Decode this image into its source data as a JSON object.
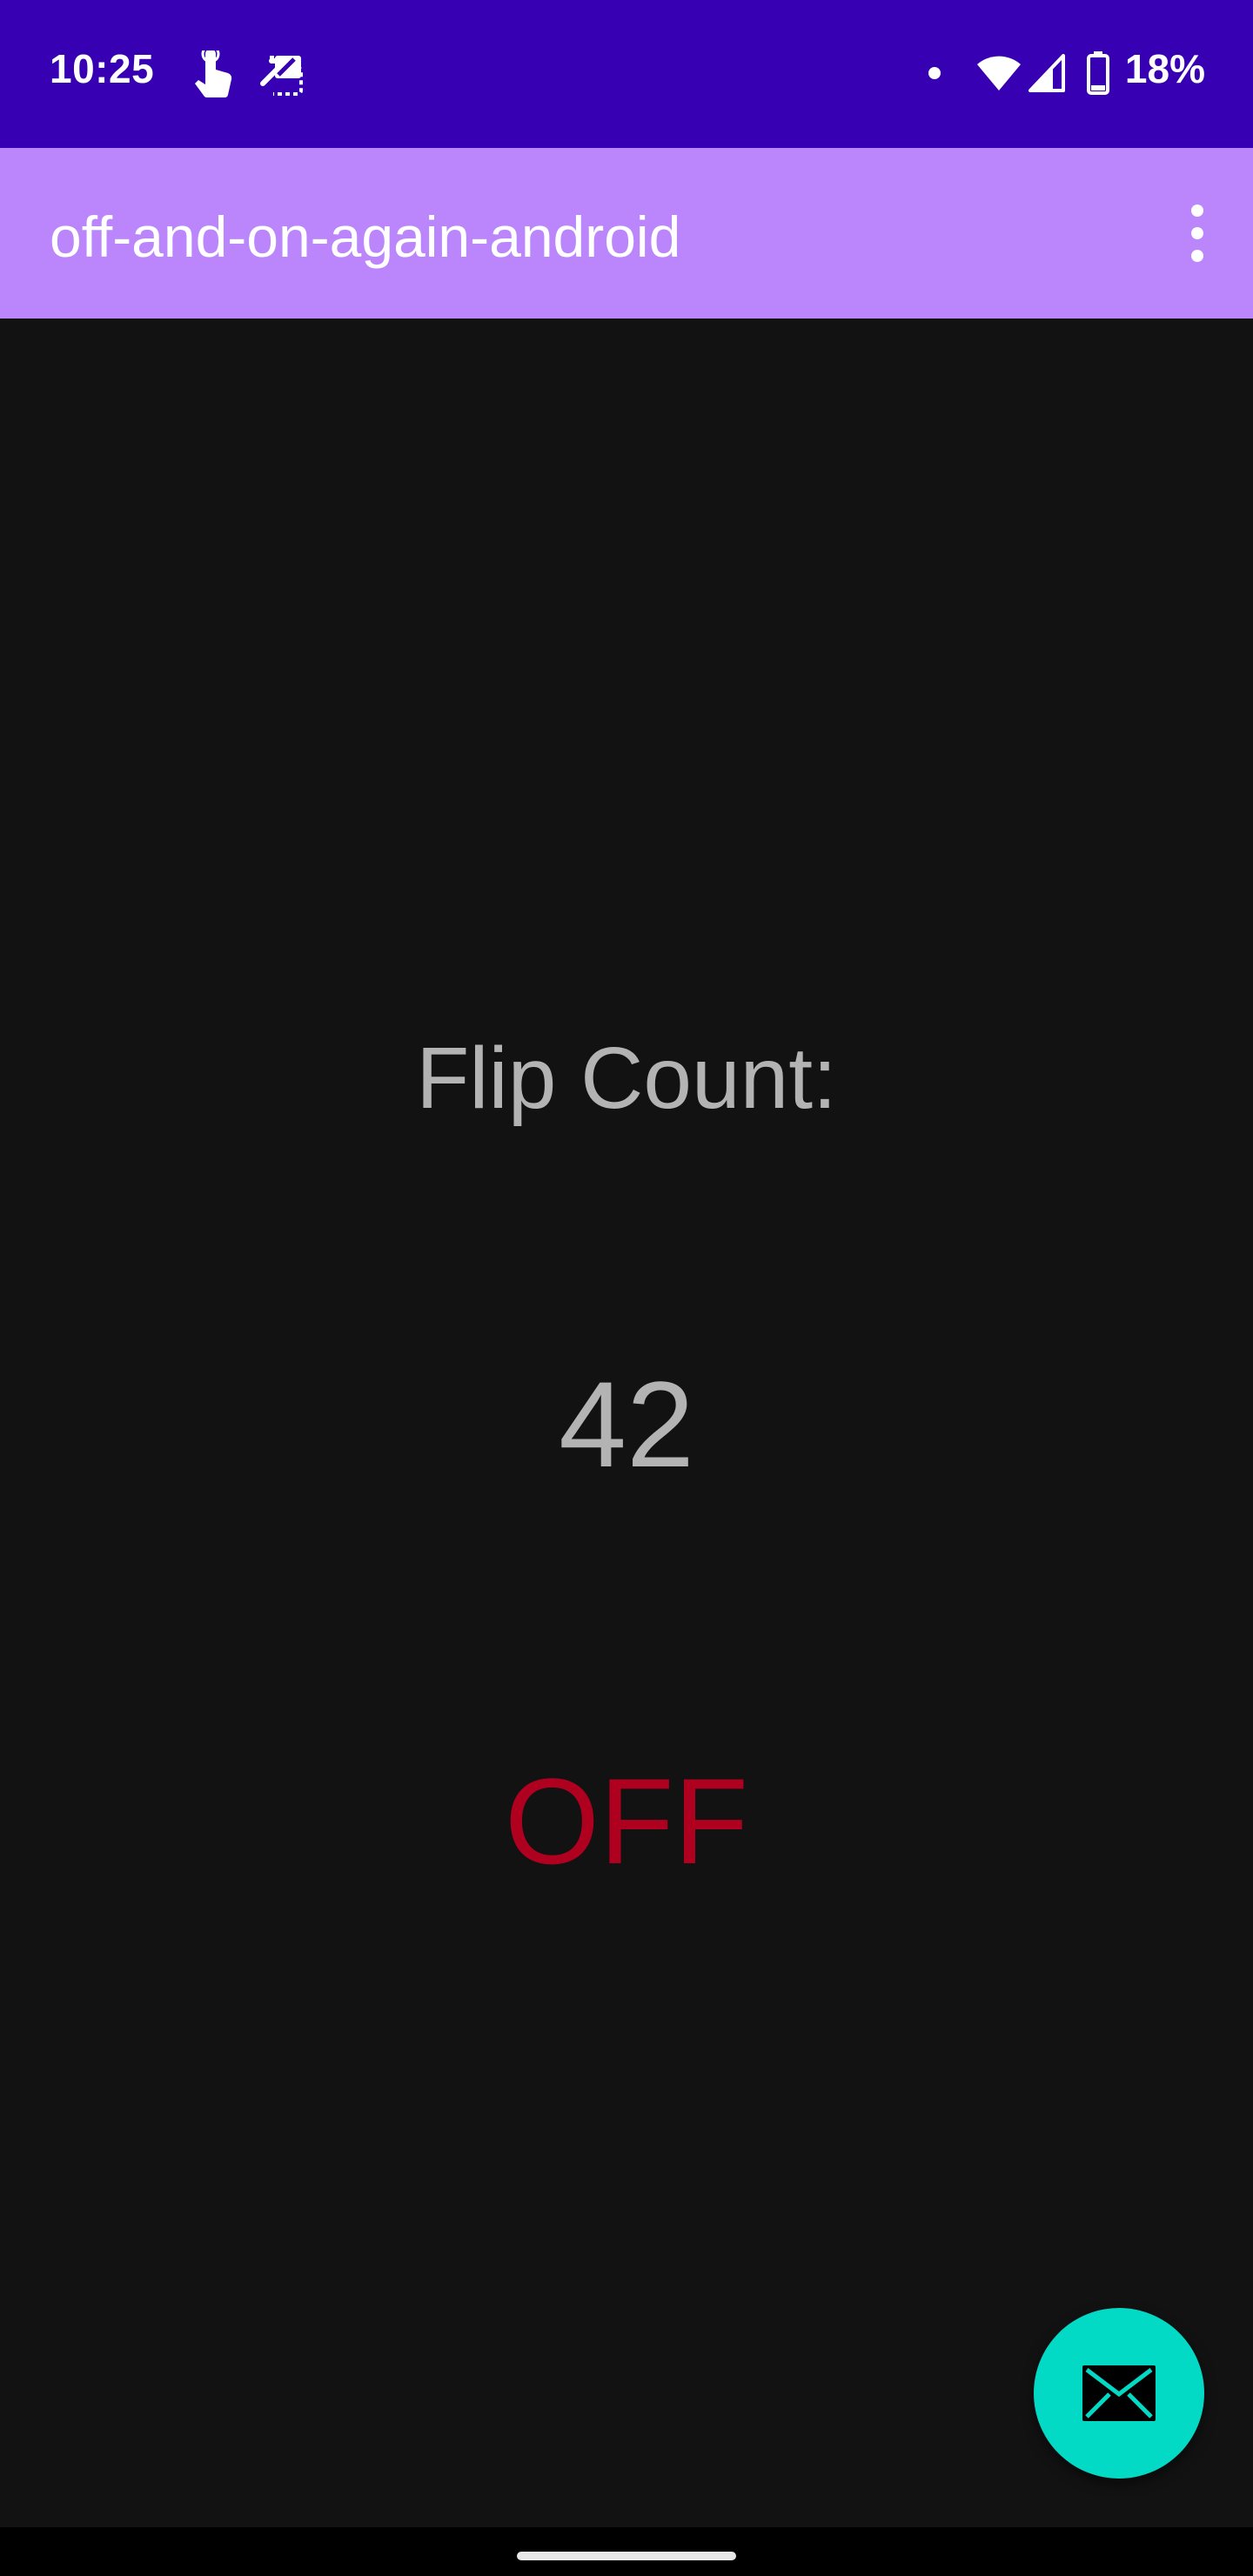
{
  "status_bar": {
    "time": "10:25",
    "battery": "18%",
    "bg_color": "#3700b3",
    "icons": [
      "touch-notification-icon",
      "screen-cast-icon",
      "notification-dot-icon",
      "wifi-icon",
      "cell-signal-icon",
      "battery-icon"
    ]
  },
  "app_bar": {
    "title": "off-and-on-again-android",
    "bg_color": "#bb86fc",
    "menu_icon": "more-vert-icon"
  },
  "main": {
    "flip_label": "Flip Count:",
    "flip_count": "42",
    "state": "OFF",
    "state_color": "#b00020",
    "text_color": "#b3b3b3",
    "background": "#121212"
  },
  "fab": {
    "icon": "mail-icon",
    "color": "#03dac6"
  }
}
